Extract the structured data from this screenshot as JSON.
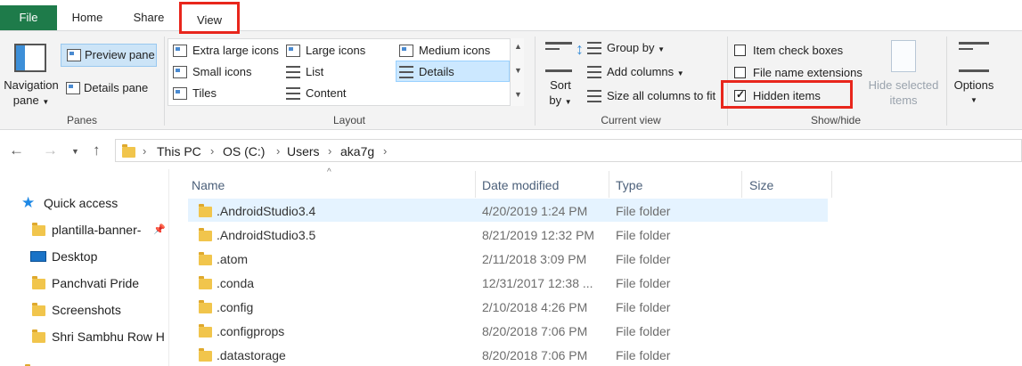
{
  "tabs": {
    "file": "File",
    "home": "Home",
    "share": "Share",
    "view": "View"
  },
  "ribbon": {
    "panes": {
      "group": "Panes",
      "navigation_pane_1": "Navigation",
      "navigation_pane_2": "pane",
      "preview_pane": "Preview pane",
      "details_pane": "Details pane"
    },
    "layout": {
      "group": "Layout",
      "extra_large_icons": "Extra large icons",
      "large_icons": "Large icons",
      "medium_icons": "Medium icons",
      "small_icons": "Small icons",
      "list": "List",
      "details": "Details",
      "tiles": "Tiles",
      "content": "Content"
    },
    "current_view": {
      "group": "Current view",
      "sort_by_1": "Sort",
      "sort_by_2": "by",
      "group_by": "Group by",
      "add_columns": "Add columns",
      "size_all_columns": "Size all columns to fit"
    },
    "show_hide": {
      "group": "Show/hide",
      "item_check_boxes": "Item check boxes",
      "file_name_extensions": "File name extensions",
      "hidden_items": "Hidden items",
      "hide_selected_1": "Hide selected",
      "hide_selected_2": "items",
      "options": "Options",
      "item_check_boxes_checked": false,
      "file_name_extensions_checked": false,
      "hidden_items_checked": true
    }
  },
  "address": {
    "crumbs": [
      "This PC",
      "OS (C:)",
      "Users",
      "aka7g"
    ]
  },
  "nav": {
    "quick_access": "Quick access",
    "items": [
      "plantilla-banner-",
      "Desktop",
      "Panchvati Pride",
      "Screenshots",
      "Shri Sambhu Row H"
    ]
  },
  "columns": {
    "name": "Name",
    "date": "Date modified",
    "type": "Type",
    "size": "Size"
  },
  "files": [
    {
      "name": ".AndroidStudio3.4",
      "date": "4/20/2019 1:24 PM",
      "type": "File folder"
    },
    {
      "name": ".AndroidStudio3.5",
      "date": "8/21/2019 12:32 PM",
      "type": "File folder"
    },
    {
      "name": ".atom",
      "date": "2/11/2018 3:09 PM",
      "type": "File folder"
    },
    {
      "name": ".conda",
      "date": "12/31/2017 12:38 ...",
      "type": "File folder"
    },
    {
      "name": ".config",
      "date": "2/10/2018 4:26 PM",
      "type": "File folder"
    },
    {
      "name": ".configprops",
      "date": "8/20/2018 7:06 PM",
      "type": "File folder"
    },
    {
      "name": ".datastorage",
      "date": "8/20/2018 7:06 PM",
      "type": "File folder"
    }
  ],
  "colors": {
    "file_tab": "#1e7b4a",
    "highlight": "#e8261c",
    "selection": "#e5f3ff",
    "folder": "#f1c54c"
  },
  "icons": [
    "navigation-pane-icon",
    "preview-pane-icon",
    "details-pane-icon",
    "folder-icon",
    "star-icon",
    "desktop-icon",
    "pin-icon",
    "back-arrow-icon",
    "forward-arrow-icon",
    "up-arrow-icon",
    "chevron-down-icon"
  ]
}
